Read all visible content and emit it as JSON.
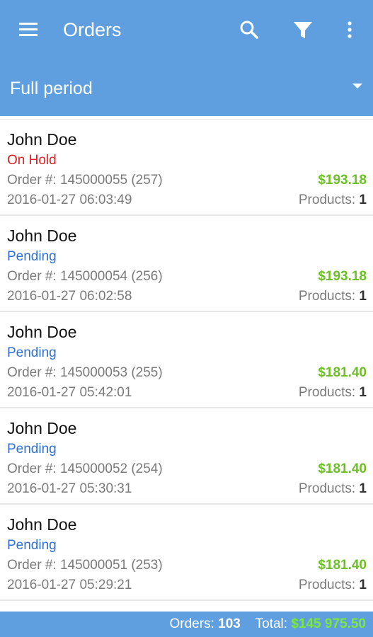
{
  "toolbar": {
    "title": "Orders",
    "icons": [
      "menu-icon",
      "search-icon",
      "filter-icon",
      "more-vert-icon"
    ]
  },
  "period": {
    "selected": "Full period"
  },
  "colors": {
    "appbar": "#5f9fe0",
    "status_on_hold": "#e02020",
    "status_pending": "#2f6fd6",
    "amount": "#6cc024",
    "footer_total": "#7ce83a"
  },
  "orders": [
    {
      "customer": "John Doe",
      "status": "On Hold",
      "status_color": "#e02020",
      "order_number": "Order #: 145000055 (257)",
      "date": "2016-01-27 06:03:49",
      "amount": "$193.18",
      "products_label": "Products:",
      "products_count": "1"
    },
    {
      "customer": "John Doe",
      "status": "Pending",
      "status_color": "#2f6fd6",
      "order_number": "Order #: 145000054 (256)",
      "date": "2016-01-27 06:02:58",
      "amount": "$193.18",
      "products_label": "Products:",
      "products_count": "1"
    },
    {
      "customer": "John Doe",
      "status": "Pending",
      "status_color": "#2f6fd6",
      "order_number": "Order #: 145000053 (255)",
      "date": "2016-01-27 05:42:01",
      "amount": "$181.40",
      "products_label": "Products:",
      "products_count": "1"
    },
    {
      "customer": "John Doe",
      "status": "Pending",
      "status_color": "#2f6fd6",
      "order_number": "Order #: 145000052 (254)",
      "date": "2016-01-27 05:30:31",
      "amount": "$181.40",
      "products_label": "Products:",
      "products_count": "1"
    },
    {
      "customer": "John Doe",
      "status": "Pending",
      "status_color": "#2f6fd6",
      "order_number": "Order #: 145000051 (253)",
      "date": "2016-01-27 05:29:21",
      "amount": "$181.40",
      "products_label": "Products:",
      "products_count": "1"
    }
  ],
  "footer": {
    "orders_label": "Orders:",
    "orders_count": "103",
    "total_label": "Total:",
    "total_value": "$145 975.50"
  }
}
